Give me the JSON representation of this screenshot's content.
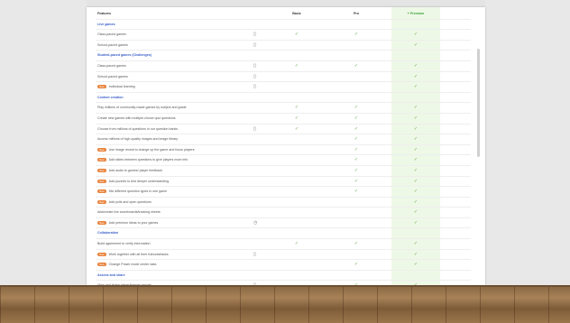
{
  "columns": {
    "feature": "Features",
    "basic": "Basic",
    "pro": "Pro",
    "premium": "+ Premium"
  },
  "rows": [
    {
      "type": "section",
      "label": "Live games"
    },
    {
      "type": "item",
      "label": "Class-paced games",
      "icon": "▯",
      "basic": "✓",
      "pro": "✓",
      "premium": "✓"
    },
    {
      "type": "item",
      "label": "School-paced games",
      "icon": "▯",
      "basic": "",
      "pro": "",
      "premium": "✓"
    },
    {
      "type": "section",
      "label": "Student-paced games (Challenges)"
    },
    {
      "type": "item",
      "label": "Class-paced games",
      "icon": "▯",
      "basic": "✓",
      "pro": "✓",
      "premium": "✓"
    },
    {
      "type": "item",
      "label": "School-paced games",
      "icon": "▯",
      "basic": "",
      "pro": "",
      "premium": "✓"
    },
    {
      "type": "item",
      "badge": "New",
      "label": "Individual learning",
      "icon": "▯",
      "basic": "",
      "pro": "",
      "premium": "✓"
    },
    {
      "type": "section",
      "label": "Content creation"
    },
    {
      "type": "item",
      "label": "Play millions of community-made games by subject and grade",
      "icon": "",
      "basic": "✓",
      "pro": "✓",
      "premium": "✓"
    },
    {
      "type": "item",
      "label": "Create new games with multiple-choice quiz questions",
      "icon": "",
      "basic": "✓",
      "pro": "✓",
      "premium": "✓"
    },
    {
      "type": "item",
      "label": "Choose from millions of questions in our question banks",
      "icon": "▯",
      "basic": "✓",
      "pro": "✓",
      "premium": "✓"
    },
    {
      "type": "item",
      "label": "Access millions of high-quality images and image library",
      "icon": "",
      "basic": "",
      "pro": "✓",
      "premium": "✓"
    },
    {
      "type": "item",
      "badge": "New",
      "label": "Use image reveal to change up the game and focus players",
      "icon": "",
      "basic": "",
      "pro": "✓",
      "premium": "✓"
    },
    {
      "type": "item",
      "badge": "New",
      "label": "Add slides between questions to give players more info",
      "icon": "",
      "basic": "",
      "pro": "✓",
      "premium": "✓"
    },
    {
      "type": "item",
      "badge": "New",
      "label": "Add audio to games/ player feedback",
      "icon": "",
      "basic": "",
      "pro": "✓",
      "premium": "✓"
    },
    {
      "type": "item",
      "badge": "New",
      "label": "Add puzzles to test deeper understanding",
      "icon": "",
      "basic": "",
      "pro": "✓",
      "premium": "✓"
    },
    {
      "type": "item",
      "badge": "New",
      "label": "Mix different question types in one game",
      "icon": "",
      "basic": "",
      "pro": "✓",
      "premium": "✓"
    },
    {
      "type": "item",
      "badge": "New",
      "label": "Add polls and open questions",
      "icon": "",
      "basic": "",
      "pro": "",
      "premium": "✓"
    },
    {
      "type": "item",
      "label": "Add/create live scoreboards/tracking sheets",
      "icon": "",
      "basic": "",
      "pro": "",
      "premium": "✓"
    },
    {
      "type": "item",
      "badge": "New",
      "label": "Add premium ideas to your games",
      "icon": "◷",
      "basic": "",
      "pro": "",
      "premium": "✓"
    },
    {
      "type": "section",
      "label": "Collaboration"
    },
    {
      "type": "item",
      "label": "Build agreement to verify information",
      "icon": "",
      "basic": "✓",
      "pro": "✓",
      "premium": "✓"
    },
    {
      "type": "item",
      "badge": "New",
      "label": "Work together with all their Kahoots/tasks",
      "icon": "▯",
      "basic": "",
      "pro": "",
      "premium": "✓"
    },
    {
      "type": "item",
      "badge": "New",
      "label": "Change Power mode center data",
      "icon": "",
      "basic": "",
      "pro": "✓",
      "premium": "✓"
    },
    {
      "type": "section",
      "label": "Assess and share"
    },
    {
      "type": "item",
      "label": "View and share player/learner reports",
      "icon": "▯",
      "basic": "",
      "pro": "✓",
      "premium": "✓"
    }
  ]
}
